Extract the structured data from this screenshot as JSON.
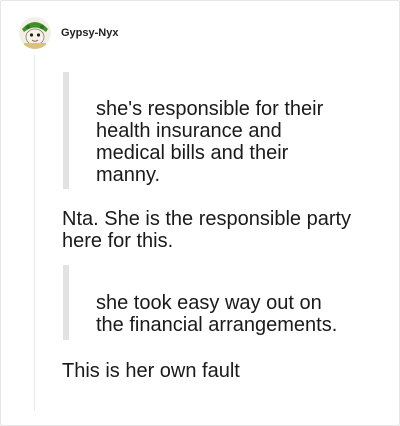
{
  "post": {
    "username": "Gypsy-Nyx",
    "avatar_icon": "gypsy-avatar-icon",
    "quote_1": "she's responsible for their health insurance and medical bills and their manny.",
    "reply_1": "Nta. She is the responsible party here for this.",
    "quote_2": "she took easy way out on the financial arrangements.",
    "reply_2": "This is her own fault"
  },
  "colors": {
    "quote_bar": "#e2e2e2",
    "thread_line": "#e8e8e8",
    "avatar_green": "#3f8f2b"
  }
}
